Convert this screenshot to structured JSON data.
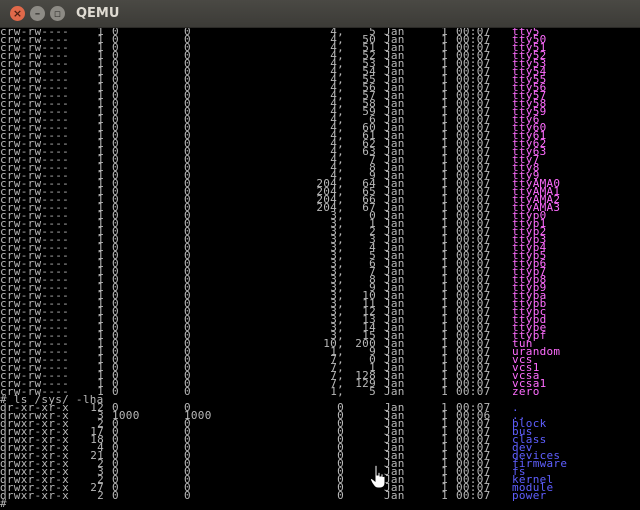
{
  "window": {
    "title": "QEMU",
    "buttons": {
      "close": "×",
      "minimize": "–",
      "maximize": "▫"
    }
  },
  "colors": {
    "device": "#ff6cff",
    "directory": "#5f5fff",
    "text": "#b8b8b8"
  },
  "devices": [
    {
      "perm": "crw-rw----",
      "links": "1",
      "user": "0",
      "group": "0",
      "major": "4,",
      "minor": "5",
      "month": "Jan",
      "day": "1",
      "time": "00:07",
      "name": "tty5"
    },
    {
      "perm": "crw-rw----",
      "links": "1",
      "user": "0",
      "group": "0",
      "major": "4,",
      "minor": "50",
      "month": "Jan",
      "day": "1",
      "time": "00:07",
      "name": "tty50"
    },
    {
      "perm": "crw-rw----",
      "links": "1",
      "user": "0",
      "group": "0",
      "major": "4,",
      "minor": "51",
      "month": "Jan",
      "day": "1",
      "time": "00:07",
      "name": "tty51"
    },
    {
      "perm": "crw-rw----",
      "links": "1",
      "user": "0",
      "group": "0",
      "major": "4,",
      "minor": "52",
      "month": "Jan",
      "day": "1",
      "time": "00:07",
      "name": "tty52"
    },
    {
      "perm": "crw-rw----",
      "links": "1",
      "user": "0",
      "group": "0",
      "major": "4,",
      "minor": "53",
      "month": "Jan",
      "day": "1",
      "time": "00:07",
      "name": "tty53"
    },
    {
      "perm": "crw-rw----",
      "links": "1",
      "user": "0",
      "group": "0",
      "major": "4,",
      "minor": "54",
      "month": "Jan",
      "day": "1",
      "time": "00:07",
      "name": "tty54"
    },
    {
      "perm": "crw-rw----",
      "links": "1",
      "user": "0",
      "group": "0",
      "major": "4,",
      "minor": "55",
      "month": "Jan",
      "day": "1",
      "time": "00:07",
      "name": "tty55"
    },
    {
      "perm": "crw-rw----",
      "links": "1",
      "user": "0",
      "group": "0",
      "major": "4,",
      "minor": "56",
      "month": "Jan",
      "day": "1",
      "time": "00:07",
      "name": "tty56"
    },
    {
      "perm": "crw-rw----",
      "links": "1",
      "user": "0",
      "group": "0",
      "major": "4,",
      "minor": "57",
      "month": "Jan",
      "day": "1",
      "time": "00:07",
      "name": "tty57"
    },
    {
      "perm": "crw-rw----",
      "links": "1",
      "user": "0",
      "group": "0",
      "major": "4,",
      "minor": "58",
      "month": "Jan",
      "day": "1",
      "time": "00:07",
      "name": "tty58"
    },
    {
      "perm": "crw-rw----",
      "links": "1",
      "user": "0",
      "group": "0",
      "major": "4,",
      "minor": "59",
      "month": "Jan",
      "day": "1",
      "time": "00:07",
      "name": "tty59"
    },
    {
      "perm": "crw-rw----",
      "links": "1",
      "user": "0",
      "group": "0",
      "major": "4,",
      "minor": "6",
      "month": "Jan",
      "day": "1",
      "time": "00:07",
      "name": "tty6"
    },
    {
      "perm": "crw-rw----",
      "links": "1",
      "user": "0",
      "group": "0",
      "major": "4,",
      "minor": "60",
      "month": "Jan",
      "day": "1",
      "time": "00:07",
      "name": "tty60"
    },
    {
      "perm": "crw-rw----",
      "links": "1",
      "user": "0",
      "group": "0",
      "major": "4,",
      "minor": "61",
      "month": "Jan",
      "day": "1",
      "time": "00:07",
      "name": "tty61"
    },
    {
      "perm": "crw-rw----",
      "links": "1",
      "user": "0",
      "group": "0",
      "major": "4,",
      "minor": "62",
      "month": "Jan",
      "day": "1",
      "time": "00:07",
      "name": "tty62"
    },
    {
      "perm": "crw-rw----",
      "links": "1",
      "user": "0",
      "group": "0",
      "major": "4,",
      "minor": "63",
      "month": "Jan",
      "day": "1",
      "time": "00:07",
      "name": "tty63"
    },
    {
      "perm": "crw-rw----",
      "links": "1",
      "user": "0",
      "group": "0",
      "major": "4,",
      "minor": "7",
      "month": "Jan",
      "day": "1",
      "time": "00:07",
      "name": "tty7"
    },
    {
      "perm": "crw-rw----",
      "links": "1",
      "user": "0",
      "group": "0",
      "major": "4,",
      "minor": "8",
      "month": "Jan",
      "day": "1",
      "time": "00:07",
      "name": "tty8"
    },
    {
      "perm": "crw-rw----",
      "links": "1",
      "user": "0",
      "group": "0",
      "major": "4,",
      "minor": "9",
      "month": "Jan",
      "day": "1",
      "time": "00:07",
      "name": "tty9"
    },
    {
      "perm": "crw-rw----",
      "links": "1",
      "user": "0",
      "group": "0",
      "major": "204,",
      "minor": "64",
      "month": "Jan",
      "day": "1",
      "time": "00:07",
      "name": "ttyAMA0"
    },
    {
      "perm": "crw-rw----",
      "links": "1",
      "user": "0",
      "group": "0",
      "major": "204,",
      "minor": "65",
      "month": "Jan",
      "day": "1",
      "time": "00:07",
      "name": "ttyAMA1"
    },
    {
      "perm": "crw-rw----",
      "links": "1",
      "user": "0",
      "group": "0",
      "major": "204,",
      "minor": "66",
      "month": "Jan",
      "day": "1",
      "time": "00:07",
      "name": "ttyAMA2"
    },
    {
      "perm": "crw-rw----",
      "links": "1",
      "user": "0",
      "group": "0",
      "major": "204,",
      "minor": "67",
      "month": "Jan",
      "day": "1",
      "time": "00:07",
      "name": "ttyAMA3"
    },
    {
      "perm": "crw-rw----",
      "links": "1",
      "user": "0",
      "group": "0",
      "major": "3,",
      "minor": "0",
      "month": "Jan",
      "day": "1",
      "time": "00:07",
      "name": "ttyp0"
    },
    {
      "perm": "crw-rw----",
      "links": "1",
      "user": "0",
      "group": "0",
      "major": "3,",
      "minor": "1",
      "month": "Jan",
      "day": "1",
      "time": "00:07",
      "name": "ttyp1"
    },
    {
      "perm": "crw-rw----",
      "links": "1",
      "user": "0",
      "group": "0",
      "major": "3,",
      "minor": "2",
      "month": "Jan",
      "day": "1",
      "time": "00:07",
      "name": "ttyp2"
    },
    {
      "perm": "crw-rw----",
      "links": "1",
      "user": "0",
      "group": "0",
      "major": "3,",
      "minor": "3",
      "month": "Jan",
      "day": "1",
      "time": "00:07",
      "name": "ttyp3"
    },
    {
      "perm": "crw-rw----",
      "links": "1",
      "user": "0",
      "group": "0",
      "major": "3,",
      "minor": "4",
      "month": "Jan",
      "day": "1",
      "time": "00:07",
      "name": "ttyp4"
    },
    {
      "perm": "crw-rw----",
      "links": "1",
      "user": "0",
      "group": "0",
      "major": "3,",
      "minor": "5",
      "month": "Jan",
      "day": "1",
      "time": "00:07",
      "name": "ttyp5"
    },
    {
      "perm": "crw-rw----",
      "links": "1",
      "user": "0",
      "group": "0",
      "major": "3,",
      "minor": "6",
      "month": "Jan",
      "day": "1",
      "time": "00:07",
      "name": "ttyp6"
    },
    {
      "perm": "crw-rw----",
      "links": "1",
      "user": "0",
      "group": "0",
      "major": "3,",
      "minor": "7",
      "month": "Jan",
      "day": "1",
      "time": "00:07",
      "name": "ttyp7"
    },
    {
      "perm": "crw-rw----",
      "links": "1",
      "user": "0",
      "group": "0",
      "major": "3,",
      "minor": "8",
      "month": "Jan",
      "day": "1",
      "time": "00:07",
      "name": "ttyp8"
    },
    {
      "perm": "crw-rw----",
      "links": "1",
      "user": "0",
      "group": "0",
      "major": "3,",
      "minor": "9",
      "month": "Jan",
      "day": "1",
      "time": "00:07",
      "name": "ttyp9"
    },
    {
      "perm": "crw-rw----",
      "links": "1",
      "user": "0",
      "group": "0",
      "major": "3,",
      "minor": "10",
      "month": "Jan",
      "day": "1",
      "time": "00:07",
      "name": "ttypa"
    },
    {
      "perm": "crw-rw----",
      "links": "1",
      "user": "0",
      "group": "0",
      "major": "3,",
      "minor": "11",
      "month": "Jan",
      "day": "1",
      "time": "00:07",
      "name": "ttypb"
    },
    {
      "perm": "crw-rw----",
      "links": "1",
      "user": "0",
      "group": "0",
      "major": "3,",
      "minor": "12",
      "month": "Jan",
      "day": "1",
      "time": "00:07",
      "name": "ttypc"
    },
    {
      "perm": "crw-rw----",
      "links": "1",
      "user": "0",
      "group": "0",
      "major": "3,",
      "minor": "13",
      "month": "Jan",
      "day": "1",
      "time": "00:07",
      "name": "ttypd"
    },
    {
      "perm": "crw-rw----",
      "links": "1",
      "user": "0",
      "group": "0",
      "major": "3,",
      "minor": "14",
      "month": "Jan",
      "day": "1",
      "time": "00:07",
      "name": "ttype"
    },
    {
      "perm": "crw-rw----",
      "links": "1",
      "user": "0",
      "group": "0",
      "major": "3,",
      "minor": "15",
      "month": "Jan",
      "day": "1",
      "time": "00:07",
      "name": "ttypf"
    },
    {
      "perm": "crw-rw----",
      "links": "1",
      "user": "0",
      "group": "0",
      "major": "10,",
      "minor": "200",
      "month": "Jan",
      "day": "1",
      "time": "00:07",
      "name": "tun"
    },
    {
      "perm": "crw-rw----",
      "links": "1",
      "user": "0",
      "group": "0",
      "major": "1,",
      "minor": "9",
      "month": "Jan",
      "day": "1",
      "time": "00:07",
      "name": "urandom"
    },
    {
      "perm": "crw-rw----",
      "links": "1",
      "user": "0",
      "group": "0",
      "major": "7,",
      "minor": "0",
      "month": "Jan",
      "day": "1",
      "time": "00:07",
      "name": "vcs"
    },
    {
      "perm": "crw-rw----",
      "links": "1",
      "user": "0",
      "group": "0",
      "major": "7,",
      "minor": "1",
      "month": "Jan",
      "day": "1",
      "time": "00:07",
      "name": "vcs1"
    },
    {
      "perm": "crw-rw----",
      "links": "1",
      "user": "0",
      "group": "0",
      "major": "7,",
      "minor": "128",
      "month": "Jan",
      "day": "1",
      "time": "00:07",
      "name": "vcsa"
    },
    {
      "perm": "crw-rw----",
      "links": "1",
      "user": "0",
      "group": "0",
      "major": "7,",
      "minor": "129",
      "month": "Jan",
      "day": "1",
      "time": "00:07",
      "name": "vcsa1"
    },
    {
      "perm": "crw-rw----",
      "links": "1",
      "user": "0",
      "group": "0",
      "major": "1,",
      "minor": "5",
      "month": "Jan",
      "day": "1",
      "time": "00:07",
      "name": "zero"
    }
  ],
  "command": "# ls /sys/ -lha",
  "sys_entries": [
    {
      "perm": "dr-xr-xr-x",
      "links": "12",
      "user": "0",
      "group": "0",
      "size": "0",
      "month": "Jan",
      "day": "1",
      "time": "00:07",
      "name": "."
    },
    {
      "perm": "drwxrwxr-x",
      "links": "3",
      "user": "1000",
      "group": "1000",
      "size": "0",
      "month": "Jan",
      "day": "1",
      "time": "00:06",
      "name": ".."
    },
    {
      "perm": "drwxr-xr-x",
      "links": "2",
      "user": "0",
      "group": "0",
      "size": "0",
      "month": "Jan",
      "day": "1",
      "time": "00:07",
      "name": "block"
    },
    {
      "perm": "drwxr-xr-x",
      "links": "17",
      "user": "0",
      "group": "0",
      "size": "0",
      "month": "Jan",
      "day": "1",
      "time": "00:07",
      "name": "bus"
    },
    {
      "perm": "drwxr-xr-x",
      "links": "18",
      "user": "0",
      "group": "0",
      "size": "0",
      "month": "Jan",
      "day": "1",
      "time": "00:07",
      "name": "class"
    },
    {
      "perm": "drwxr-xr-x",
      "links": "4",
      "user": "0",
      "group": "0",
      "size": "0",
      "month": "Jan",
      "day": "1",
      "time": "00:07",
      "name": "dev"
    },
    {
      "perm": "drwxr-xr-x",
      "links": "21",
      "user": "0",
      "group": "0",
      "size": "0",
      "month": "Jan",
      "day": "1",
      "time": "00:07",
      "name": "devices"
    },
    {
      "perm": "drwxr-xr-x",
      "links": "2",
      "user": "0",
      "group": "0",
      "size": "0",
      "month": "Jan",
      "day": "1",
      "time": "00:07",
      "name": "firmware"
    },
    {
      "perm": "drwxr-xr-x",
      "links": "3",
      "user": "0",
      "group": "0",
      "size": "0",
      "month": "Jan",
      "day": "1",
      "time": "00:07",
      "name": "fs"
    },
    {
      "perm": "drwxr-xr-x",
      "links": "2",
      "user": "0",
      "group": "0",
      "size": "0",
      "month": "Jan",
      "day": "1",
      "time": "00:07",
      "name": "kernel"
    },
    {
      "perm": "drwxr-xr-x",
      "links": "27",
      "user": "0",
      "group": "0",
      "size": "0",
      "month": "Jan",
      "day": "1",
      "time": "00:07",
      "name": "module"
    },
    {
      "perm": "drwxr-xr-x",
      "links": "2",
      "user": "0",
      "group": "0",
      "size": "0",
      "month": "Jan",
      "day": "1",
      "time": "00:07",
      "name": "power"
    }
  ],
  "prompt": "#"
}
